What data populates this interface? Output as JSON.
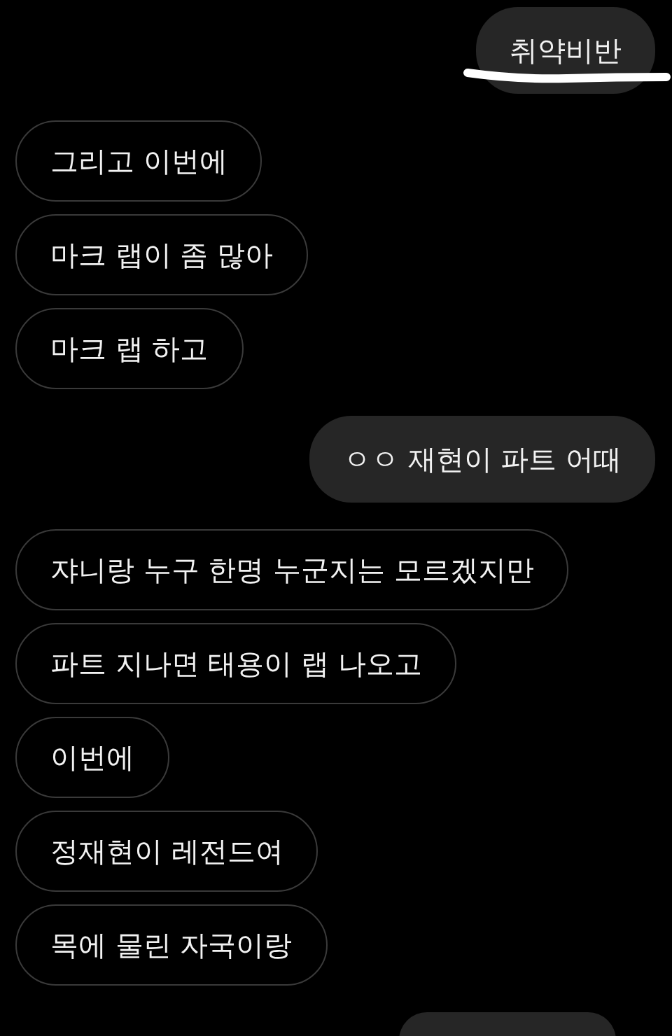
{
  "messages": [
    {
      "kind": "redacted",
      "sent": true,
      "text": "취약비반"
    },
    {
      "kind": "text",
      "sent": false,
      "text": "그리고 이번에"
    },
    {
      "kind": "text",
      "sent": false,
      "text": "마크 랩이 좀 많아"
    },
    {
      "kind": "text",
      "sent": false,
      "text": "마크 랩 하고"
    },
    {
      "kind": "text",
      "sent": true,
      "text": "ㅇㅇ 재현이 파트 어때"
    },
    {
      "kind": "text",
      "sent": false,
      "text": "쟈니랑 누구 한명 누군지는 모르겠지만"
    },
    {
      "kind": "text",
      "sent": false,
      "text": "파트 지나면 태용이 랩 나오고"
    },
    {
      "kind": "text",
      "sent": false,
      "text": "이번에"
    },
    {
      "kind": "text",
      "sent": false,
      "text": "정재현이 레전드여"
    },
    {
      "kind": "text",
      "sent": false,
      "text": "목에 물린 자국이랑"
    },
    {
      "kind": "cut",
      "sent": true
    }
  ]
}
